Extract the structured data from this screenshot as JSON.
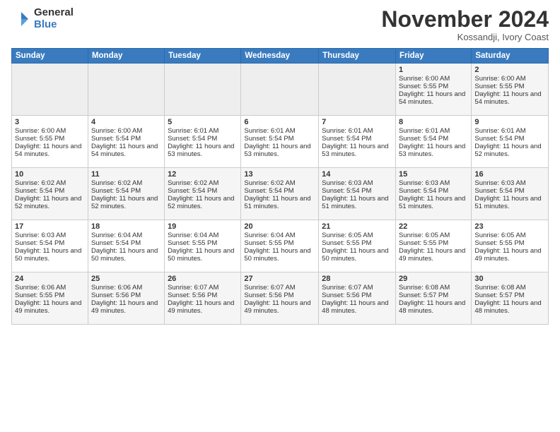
{
  "logo": {
    "general": "General",
    "blue": "Blue"
  },
  "header": {
    "month": "November 2024",
    "location": "Kossandji, Ivory Coast"
  },
  "weekdays": [
    "Sunday",
    "Monday",
    "Tuesday",
    "Wednesday",
    "Thursday",
    "Friday",
    "Saturday"
  ],
  "weeks": [
    [
      {
        "day": "",
        "empty": true
      },
      {
        "day": "",
        "empty": true
      },
      {
        "day": "",
        "empty": true
      },
      {
        "day": "",
        "empty": true
      },
      {
        "day": "",
        "empty": true
      },
      {
        "day": "1",
        "sunrise": "6:00 AM",
        "sunset": "5:55 PM",
        "daylight": "11 hours and 54 minutes."
      },
      {
        "day": "2",
        "sunrise": "6:00 AM",
        "sunset": "5:55 PM",
        "daylight": "11 hours and 54 minutes."
      }
    ],
    [
      {
        "day": "3",
        "sunrise": "6:00 AM",
        "sunset": "5:55 PM",
        "daylight": "11 hours and 54 minutes."
      },
      {
        "day": "4",
        "sunrise": "6:00 AM",
        "sunset": "5:54 PM",
        "daylight": "11 hours and 54 minutes."
      },
      {
        "day": "5",
        "sunrise": "6:01 AM",
        "sunset": "5:54 PM",
        "daylight": "11 hours and 53 minutes."
      },
      {
        "day": "6",
        "sunrise": "6:01 AM",
        "sunset": "5:54 PM",
        "daylight": "11 hours and 53 minutes."
      },
      {
        "day": "7",
        "sunrise": "6:01 AM",
        "sunset": "5:54 PM",
        "daylight": "11 hours and 53 minutes."
      },
      {
        "day": "8",
        "sunrise": "6:01 AM",
        "sunset": "5:54 PM",
        "daylight": "11 hours and 53 minutes."
      },
      {
        "day": "9",
        "sunrise": "6:01 AM",
        "sunset": "5:54 PM",
        "daylight": "11 hours and 52 minutes."
      }
    ],
    [
      {
        "day": "10",
        "sunrise": "6:02 AM",
        "sunset": "5:54 PM",
        "daylight": "11 hours and 52 minutes."
      },
      {
        "day": "11",
        "sunrise": "6:02 AM",
        "sunset": "5:54 PM",
        "daylight": "11 hours and 52 minutes."
      },
      {
        "day": "12",
        "sunrise": "6:02 AM",
        "sunset": "5:54 PM",
        "daylight": "11 hours and 52 minutes."
      },
      {
        "day": "13",
        "sunrise": "6:02 AM",
        "sunset": "5:54 PM",
        "daylight": "11 hours and 51 minutes."
      },
      {
        "day": "14",
        "sunrise": "6:03 AM",
        "sunset": "5:54 PM",
        "daylight": "11 hours and 51 minutes."
      },
      {
        "day": "15",
        "sunrise": "6:03 AM",
        "sunset": "5:54 PM",
        "daylight": "11 hours and 51 minutes."
      },
      {
        "day": "16",
        "sunrise": "6:03 AM",
        "sunset": "5:54 PM",
        "daylight": "11 hours and 51 minutes."
      }
    ],
    [
      {
        "day": "17",
        "sunrise": "6:03 AM",
        "sunset": "5:54 PM",
        "daylight": "11 hours and 50 minutes."
      },
      {
        "day": "18",
        "sunrise": "6:04 AM",
        "sunset": "5:54 PM",
        "daylight": "11 hours and 50 minutes."
      },
      {
        "day": "19",
        "sunrise": "6:04 AM",
        "sunset": "5:55 PM",
        "daylight": "11 hours and 50 minutes."
      },
      {
        "day": "20",
        "sunrise": "6:04 AM",
        "sunset": "5:55 PM",
        "daylight": "11 hours and 50 minutes."
      },
      {
        "day": "21",
        "sunrise": "6:05 AM",
        "sunset": "5:55 PM",
        "daylight": "11 hours and 50 minutes."
      },
      {
        "day": "22",
        "sunrise": "6:05 AM",
        "sunset": "5:55 PM",
        "daylight": "11 hours and 49 minutes."
      },
      {
        "day": "23",
        "sunrise": "6:05 AM",
        "sunset": "5:55 PM",
        "daylight": "11 hours and 49 minutes."
      }
    ],
    [
      {
        "day": "24",
        "sunrise": "6:06 AM",
        "sunset": "5:55 PM",
        "daylight": "11 hours and 49 minutes."
      },
      {
        "day": "25",
        "sunrise": "6:06 AM",
        "sunset": "5:56 PM",
        "daylight": "11 hours and 49 minutes."
      },
      {
        "day": "26",
        "sunrise": "6:07 AM",
        "sunset": "5:56 PM",
        "daylight": "11 hours and 49 minutes."
      },
      {
        "day": "27",
        "sunrise": "6:07 AM",
        "sunset": "5:56 PM",
        "daylight": "11 hours and 49 minutes."
      },
      {
        "day": "28",
        "sunrise": "6:07 AM",
        "sunset": "5:56 PM",
        "daylight": "11 hours and 48 minutes."
      },
      {
        "day": "29",
        "sunrise": "6:08 AM",
        "sunset": "5:57 PM",
        "daylight": "11 hours and 48 minutes."
      },
      {
        "day": "30",
        "sunrise": "6:08 AM",
        "sunset": "5:57 PM",
        "daylight": "11 hours and 48 minutes."
      }
    ]
  ],
  "labels": {
    "sunrise": "Sunrise:",
    "sunset": "Sunset:",
    "daylight": "Daylight:"
  }
}
